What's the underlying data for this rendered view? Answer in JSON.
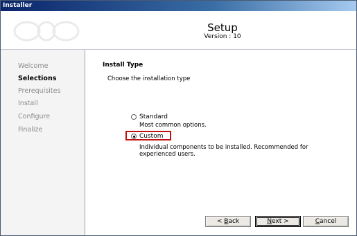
{
  "window": {
    "title": "Installer"
  },
  "header": {
    "title": "Setup",
    "version": "Version : 10"
  },
  "sidebar": {
    "steps": [
      {
        "label": "Welcome",
        "active": false
      },
      {
        "label": "Selections",
        "active": true
      },
      {
        "label": "Prerequisites",
        "active": false
      },
      {
        "label": "Install",
        "active": false
      },
      {
        "label": "Configure",
        "active": false
      },
      {
        "label": "Finalize",
        "active": false
      }
    ]
  },
  "main": {
    "section_title": "Install Type",
    "subtitle": "Choose the installation type",
    "options": [
      {
        "label": "Standard",
        "description": "Most common options.",
        "selected": false
      },
      {
        "label": "Custom",
        "description_line1": "Individual components to be installed. Recommended for",
        "description_line2": "experienced users.",
        "selected": true
      }
    ]
  },
  "buttons": {
    "back": {
      "prefix": "< ",
      "mnemonic": "B",
      "rest": "ack"
    },
    "next": {
      "mnemonic": "N",
      "rest": "ext >"
    },
    "cancel": {
      "mnemonic": "C",
      "rest": "ancel"
    }
  },
  "colors": {
    "highlight_border": "#c01010",
    "titlebar": "#0a246a"
  }
}
